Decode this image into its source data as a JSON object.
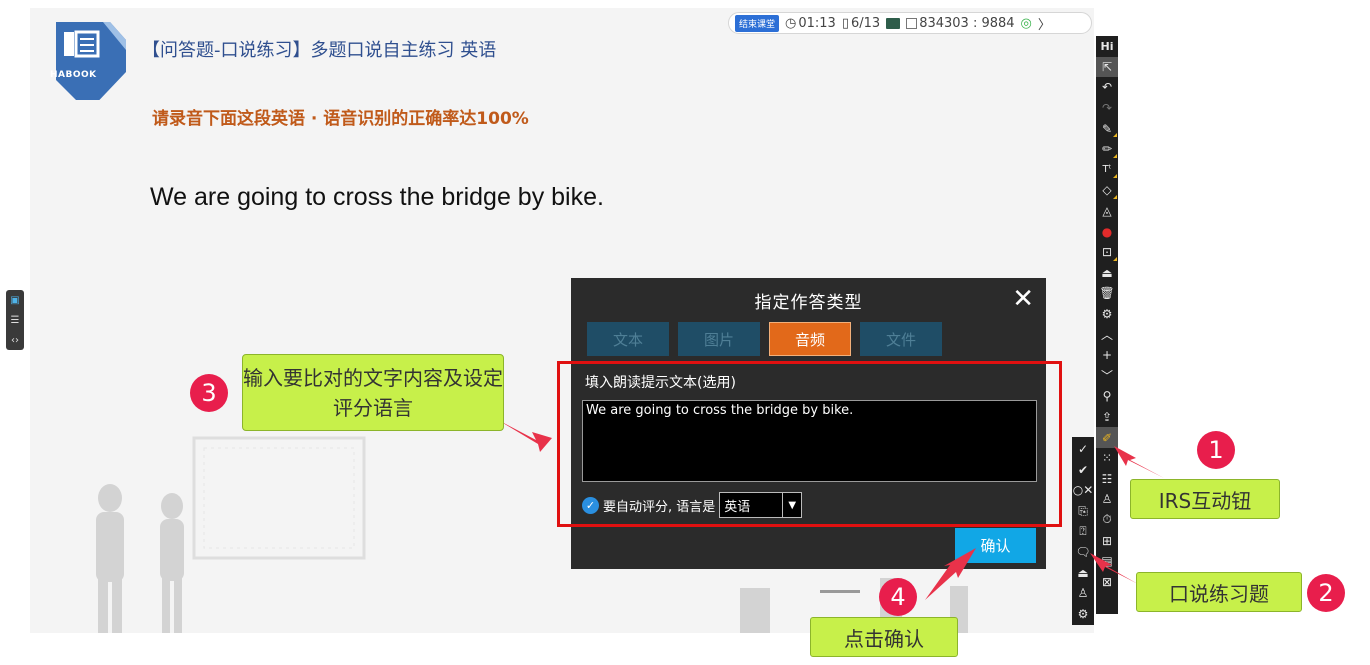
{
  "slide": {
    "logo_text": "HABOOK",
    "title": "【问答题-口说练习】多题口说自主练习 英语",
    "instruction": "请录音下面这段英语 · 语音识别的正确率达100%",
    "sentence": "We are going to cross the bridge by bike."
  },
  "statusbar": {
    "end_class_label": "结束课堂",
    "timer": "01:13",
    "page": "6/13",
    "room_code": "834303 : 9884",
    "chevron": "〉"
  },
  "toolbar": {
    "header": "Hi",
    "items": [
      "pointer-icon",
      "undo-icon",
      "redo-icon",
      "pen-icon",
      "marker-icon",
      "text-icon",
      "eraser-icon",
      "fill-icon",
      "palette-icon",
      "screenshot-icon",
      "stamp-icon",
      "trash-icon",
      "settings-icon",
      "chevron-up-icon",
      "plus-icon",
      "chevron-down-icon",
      "zoom-icon",
      "share-icon",
      "irs-pen-icon",
      "grid-icon",
      "list-icon",
      "user-icon",
      "timer-icon",
      "quiz-icon",
      "file-icon",
      "close-box-icon"
    ]
  },
  "dialog": {
    "title": "指定作答类型",
    "close": "✕",
    "tabs": [
      {
        "label": "文本",
        "active": false
      },
      {
        "label": "图片",
        "active": false
      },
      {
        "label": "音频",
        "active": true
      },
      {
        "label": "文件",
        "active": false
      }
    ],
    "field_label": "填入朗读提示文本(选用)",
    "field_value": "We are going to cross the bridge by bike.",
    "auto_label": "要自动评分, 语言是",
    "language": "英语",
    "confirm_label": "确认"
  },
  "callouts": {
    "c3_num": "3",
    "c3_text": "输入要比对的文字内容及设定评分语言",
    "c1_num": "1",
    "c1_text": "IRS互动钮",
    "c2_num": "2",
    "c2_text": "口说练习题",
    "c4_num": "4",
    "c4_text": "点击确认"
  },
  "colors": {
    "accent_orange": "#e2691a",
    "confirm_blue": "#11a7e6",
    "callout_green": "#c7f04a",
    "callout_red": "#e81e4c",
    "highlight_red": "#e01010"
  }
}
